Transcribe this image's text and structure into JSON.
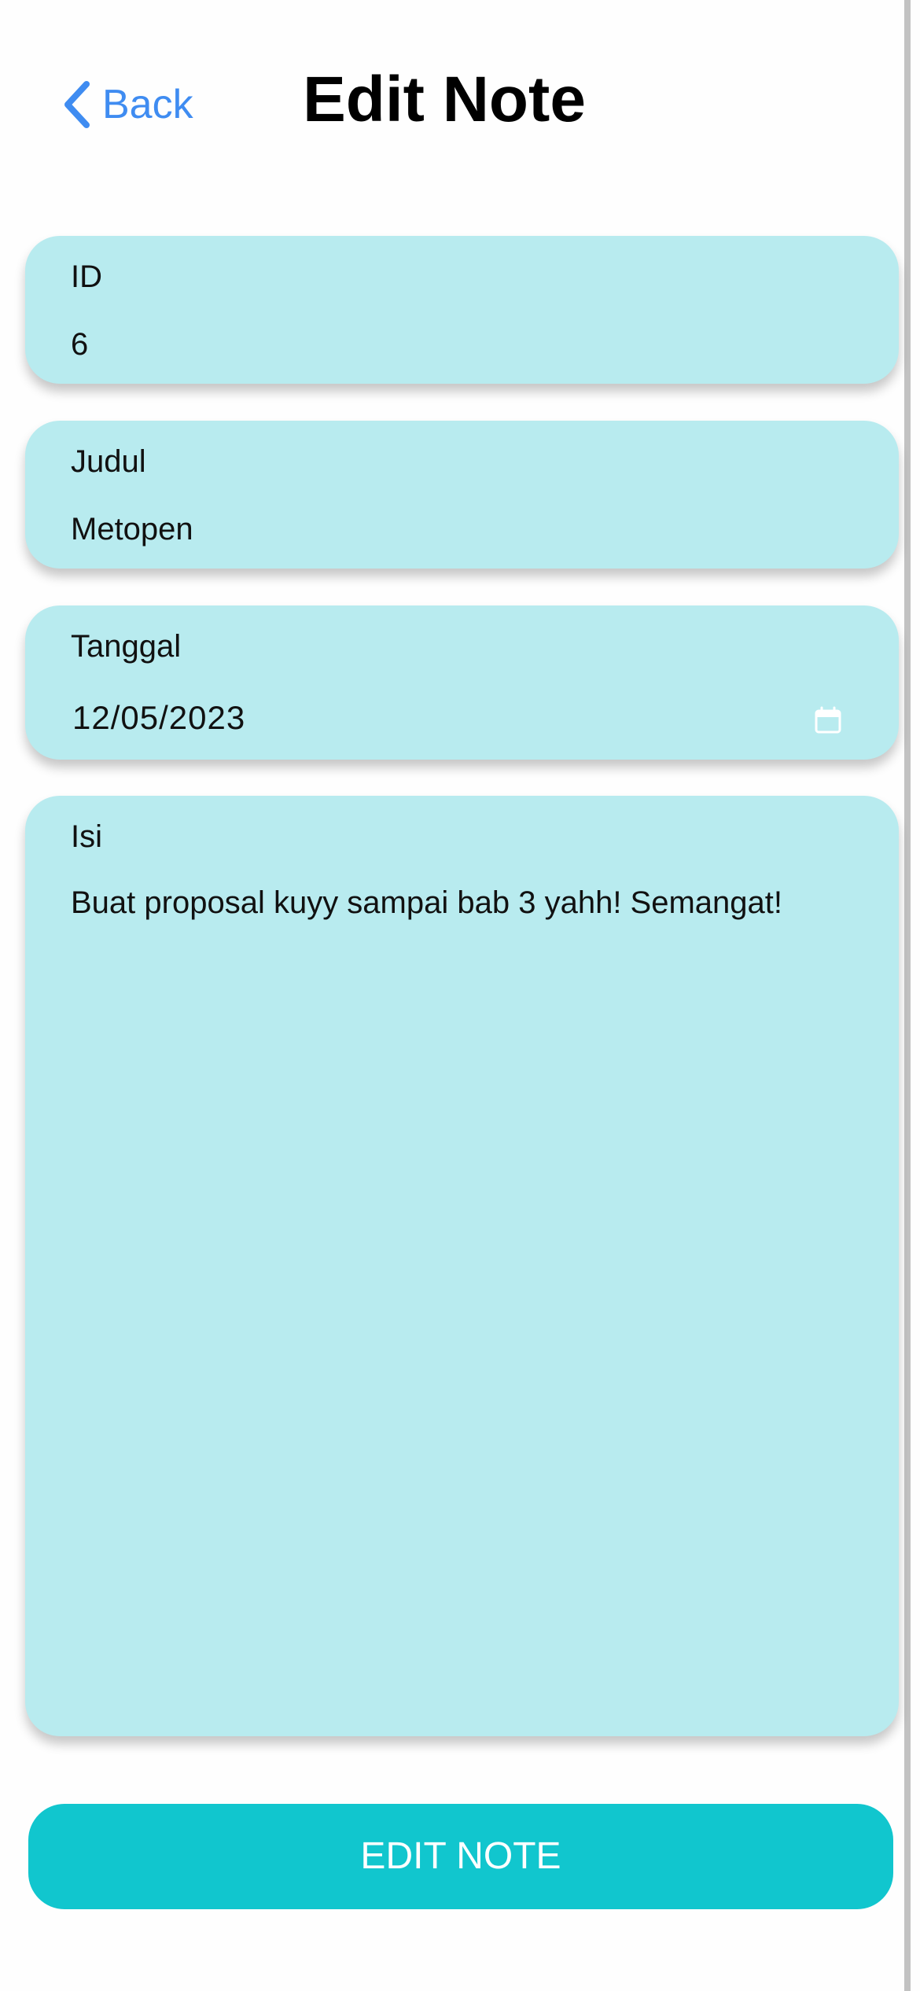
{
  "header": {
    "back_label": "Back",
    "title": "Edit Note",
    "back_icon": "chevron-left-icon"
  },
  "form": {
    "id": {
      "label": "ID",
      "value": "6"
    },
    "judul": {
      "label": "Judul",
      "value": "Metopen"
    },
    "tanggal": {
      "label": "Tanggal",
      "value": "12/05/2023",
      "icon": "calendar-icon"
    },
    "isi": {
      "label": "Isi",
      "value": "Buat proposal kuyy sampai bab 3 yahh! Semangat!"
    }
  },
  "submit": {
    "label": "EDIT NOTE"
  },
  "colors": {
    "accent_link": "#3f8cf1",
    "card_background": "#b8ebef",
    "button_background": "#11c6ce",
    "button_text": "#ffffff"
  }
}
